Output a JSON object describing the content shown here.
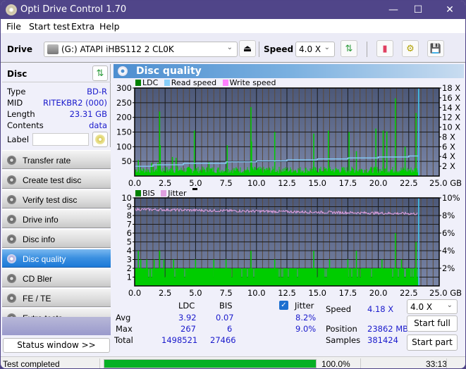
{
  "window": {
    "title": "Opti Drive Control 1.70",
    "controls": {
      "minimize": "—",
      "maximize": "☐",
      "close": "✕"
    }
  },
  "menu": [
    "File",
    "Start test",
    "Extra",
    "Help"
  ],
  "toolbar": {
    "drive_label": "Drive",
    "drive_value": "(G:)  ATAPI iHBS112  2 CL0K",
    "speed_label": "Speed",
    "speed_value": "4.0 X",
    "icons": [
      "eject-icon",
      "refresh-icon",
      "erase-icon",
      "settings-icon",
      "save-icon"
    ]
  },
  "disc": {
    "title": "Disc",
    "rows": [
      {
        "key": "Type",
        "value": "BD-R"
      },
      {
        "key": "MID",
        "value": "RITEKBR2 (000)"
      },
      {
        "key": "Length",
        "value": "23.31 GB"
      },
      {
        "key": "Contents",
        "value": "data"
      }
    ],
    "label_key": "Label",
    "label_value": ""
  },
  "nav": [
    {
      "label": "Transfer rate",
      "active": false
    },
    {
      "label": "Create test disc",
      "active": false
    },
    {
      "label": "Verify test disc",
      "active": false
    },
    {
      "label": "Drive info",
      "active": false
    },
    {
      "label": "Disc info",
      "active": false
    },
    {
      "label": "Disc quality",
      "active": true
    },
    {
      "label": "CD Bler",
      "active": false
    },
    {
      "label": "FE / TE",
      "active": false
    },
    {
      "label": "Extra tests",
      "active": false
    }
  ],
  "status_window_button": "Status window >>",
  "panel": {
    "title": "Disc quality"
  },
  "chart_data": [
    {
      "type": "bar",
      "title": "LDC / Read speed",
      "legend": [
        {
          "name": "LDC",
          "color": "#008000"
        },
        {
          "name": "Read speed",
          "color": "#87cefa"
        },
        {
          "name": "Write speed",
          "color": "#ff80ff"
        }
      ],
      "legend_position": "top-left",
      "xlabel": "GB",
      "x_ticks": [
        "0.0",
        "2.5",
        "5.0",
        "7.5",
        "10.0",
        "12.5",
        "15.0",
        "17.5",
        "20.0",
        "22.5",
        "25.0 GB"
      ],
      "xlim": [
        0,
        25
      ],
      "y_ticks_left": [
        "300",
        "250",
        "200",
        "150",
        "100",
        "50"
      ],
      "ylim_left": [
        0,
        300
      ],
      "y_ticks_right": [
        "18 X",
        "16 X",
        "14 X",
        "12 X",
        "10 X",
        "8 X",
        "6 X",
        "4 X",
        "2 X"
      ],
      "ylim_right": [
        0,
        18
      ],
      "grid": true,
      "disc_end_gb": 23.31,
      "ldc_spikes": [
        {
          "x": 0.3,
          "y": 55
        },
        {
          "x": 1.4,
          "y": 45
        },
        {
          "x": 1.9,
          "y": 45
        },
        {
          "x": 2.05,
          "y": 220
        },
        {
          "x": 2.1,
          "y": 105
        },
        {
          "x": 3.1,
          "y": 65
        },
        {
          "x": 3.4,
          "y": 62
        },
        {
          "x": 4.9,
          "y": 155
        },
        {
          "x": 6.1,
          "y": 48
        },
        {
          "x": 7.6,
          "y": 105
        },
        {
          "x": 9.55,
          "y": 235
        },
        {
          "x": 9.6,
          "y": 118
        },
        {
          "x": 11.5,
          "y": 150
        },
        {
          "x": 14.7,
          "y": 145
        },
        {
          "x": 15.9,
          "y": 155
        },
        {
          "x": 17.6,
          "y": 150
        },
        {
          "x": 18.2,
          "y": 85
        },
        {
          "x": 19.8,
          "y": 162
        },
        {
          "x": 20.4,
          "y": 155
        },
        {
          "x": 20.7,
          "y": 152
        },
        {
          "x": 21.4,
          "y": 265
        },
        {
          "x": 22.2,
          "y": 100
        },
        {
          "x": 23.1,
          "y": 215
        }
      ],
      "ldc_baseline": 25,
      "read_speed": [
        {
          "x": 0.0,
          "y": 2.0
        },
        {
          "x": 1.5,
          "y": 2.3
        },
        {
          "x": 4.0,
          "y": 2.6
        },
        {
          "x": 7.5,
          "y": 2.9
        },
        {
          "x": 10.0,
          "y": 3.1
        },
        {
          "x": 12.5,
          "y": 3.3
        },
        {
          "x": 15.0,
          "y": 3.5
        },
        {
          "x": 17.5,
          "y": 3.7
        },
        {
          "x": 20.0,
          "y": 3.9
        },
        {
          "x": 22.5,
          "y": 4.1
        },
        {
          "x": 23.3,
          "y": 4.2
        }
      ]
    },
    {
      "type": "bar",
      "title": "BIS / Jitter",
      "legend": [
        {
          "name": "BIS",
          "color": "#008000"
        },
        {
          "name": "Jitter",
          "color": "#e0a0e0"
        }
      ],
      "legend_position": "top-left",
      "xlabel": "GB",
      "x_ticks": [
        "0.0",
        "2.5",
        "5.0",
        "7.5",
        "10.0",
        "12.5",
        "15.0",
        "17.5",
        "20.0",
        "22.5",
        "25.0 GB"
      ],
      "xlim": [
        0,
        25
      ],
      "y_ticks_left": [
        "10",
        "9",
        "8",
        "7",
        "6",
        "5",
        "4",
        "3",
        "2",
        "1"
      ],
      "ylim_left": [
        0,
        10
      ],
      "y_ticks_right": [
        "10%",
        "8%",
        "6%",
        "4%",
        "2%"
      ],
      "ylim_right": [
        0,
        10
      ],
      "grid": true,
      "disc_end_gb": 23.31,
      "bis_spikes": [
        {
          "x": 0.3,
          "y": 4
        },
        {
          "x": 2.05,
          "y": 4
        },
        {
          "x": 9.55,
          "y": 4
        },
        {
          "x": 21.4,
          "y": 6
        },
        {
          "x": 14.7,
          "y": 4
        },
        {
          "x": 18.2,
          "y": 4
        },
        {
          "x": 23.1,
          "y": 5
        },
        {
          "x": 0.5,
          "y": 3
        },
        {
          "x": 1.0,
          "y": 3
        },
        {
          "x": 1.6,
          "y": 3
        },
        {
          "x": 2.4,
          "y": 3
        },
        {
          "x": 3.2,
          "y": 3
        },
        {
          "x": 5.0,
          "y": 3
        },
        {
          "x": 6.5,
          "y": 3
        },
        {
          "x": 7.5,
          "y": 3
        },
        {
          "x": 11.5,
          "y": 3
        },
        {
          "x": 16.0,
          "y": 3
        },
        {
          "x": 17.5,
          "y": 3
        },
        {
          "x": 20.3,
          "y": 3
        },
        {
          "x": 21.9,
          "y": 3
        }
      ],
      "bis_baseline": 2,
      "jitter": {
        "start": 8.7,
        "end": 8.2
      }
    }
  ],
  "stats": {
    "headers": [
      "LDC",
      "BIS"
    ],
    "rows": [
      {
        "label": "Avg",
        "ldc": "3.92",
        "bis": "0.07",
        "jitter": "8.2%"
      },
      {
        "label": "Max",
        "ldc": "267",
        "bis": "6",
        "jitter": "9.0%"
      },
      {
        "label": "Total",
        "ldc": "1498521",
        "bis": "27466",
        "jitter": ""
      }
    ],
    "jitter_label": "Jitter",
    "jitter_checked": true,
    "speed_label": "Speed",
    "speed_value": "4.18 X",
    "position_label": "Position",
    "position_value": "23862 MB",
    "samples_label": "Samples",
    "samples_value": "381424",
    "speed_select": "4.0 X",
    "start_full": "Start full",
    "start_part": "Start part"
  },
  "statusbar": {
    "text": "Test completed",
    "progress": 100.0,
    "progress_text": "100.0%",
    "time": "33:13"
  }
}
